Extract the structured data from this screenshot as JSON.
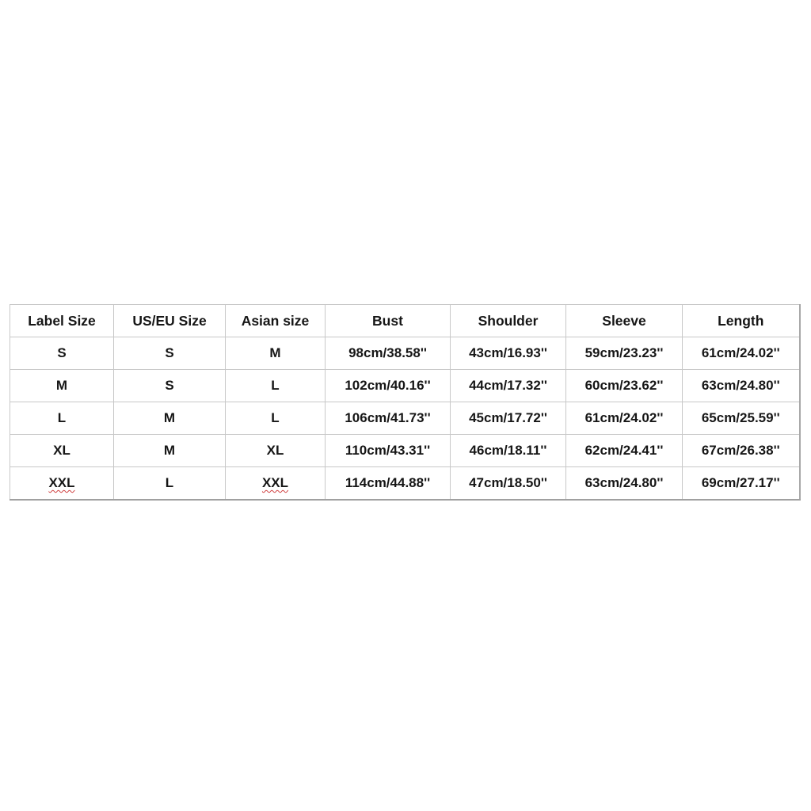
{
  "size_chart": {
    "headers": [
      "Label Size",
      "US/EU Size",
      "Asian size",
      "Bust",
      "Shoulder",
      "Sleeve",
      "Length"
    ],
    "rows": [
      [
        "S",
        "S",
        "M",
        "98cm/38.58''",
        "43cm/16.93''",
        "59cm/23.23''",
        "61cm/24.02''"
      ],
      [
        "M",
        "S",
        "L",
        "102cm/40.16''",
        "44cm/17.32''",
        "60cm/23.62''",
        "63cm/24.80''"
      ],
      [
        "L",
        "M",
        "L",
        "106cm/41.73''",
        "45cm/17.72''",
        "61cm/24.02''",
        "65cm/25.59''"
      ],
      [
        "XL",
        "M",
        "XL",
        "110cm/43.31''",
        "46cm/18.11''",
        "62cm/24.41''",
        "67cm/26.38''"
      ],
      [
        "XXL",
        "L",
        "XXL",
        "114cm/44.88''",
        "47cm/18.50''",
        "63cm/24.80''",
        "69cm/27.17''"
      ]
    ]
  }
}
